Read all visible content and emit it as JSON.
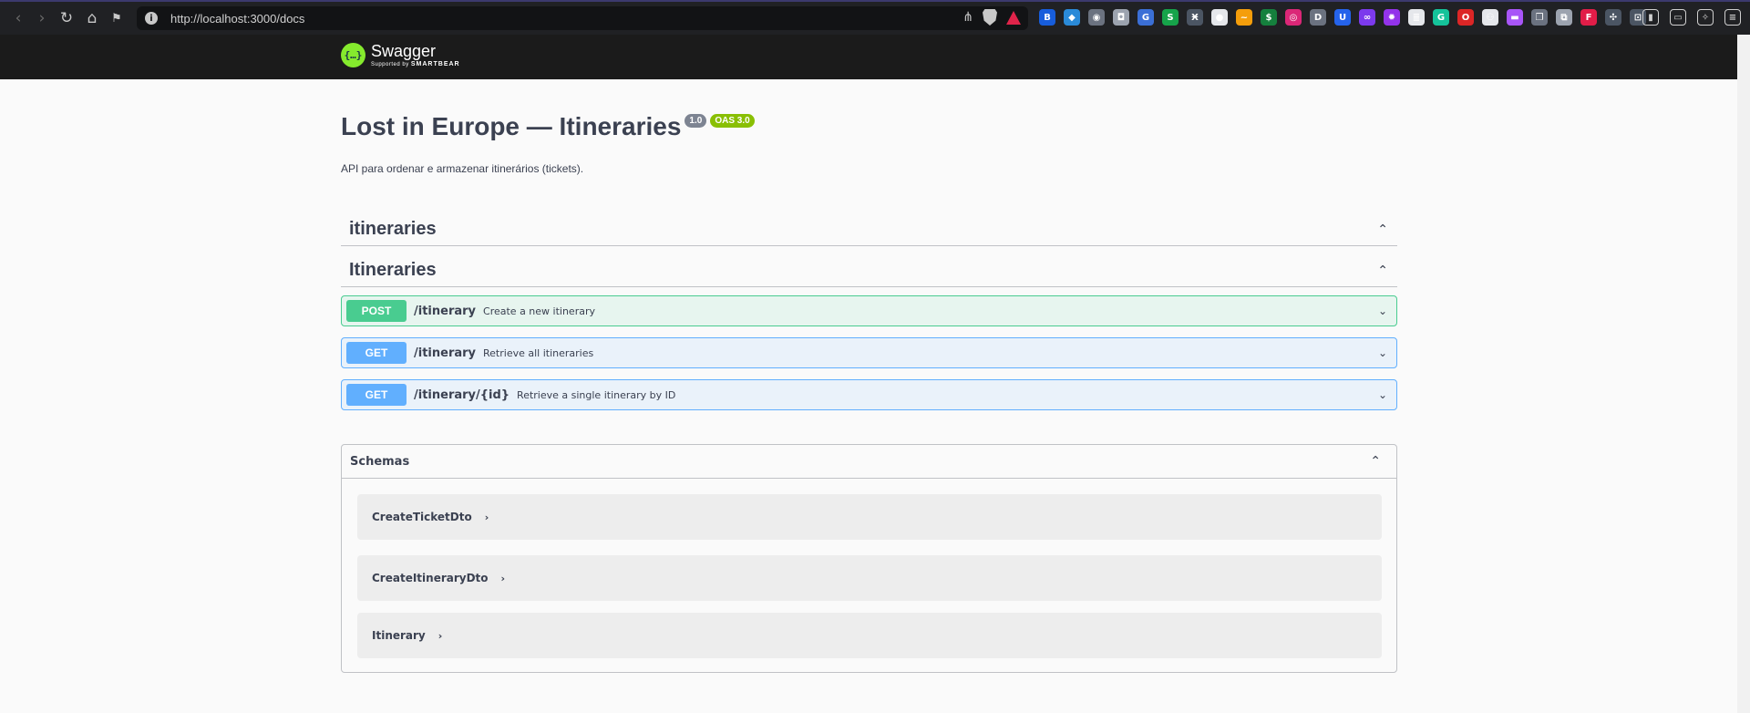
{
  "browser": {
    "url": "http://localhost:3000/docs",
    "back_icon": "‹",
    "forward_icon": "›",
    "reload_icon": "↻",
    "home_icon": "⌂",
    "bookmark_icon": "🔖",
    "info_icon": "i",
    "share_icon": "⋖",
    "extensions": [
      {
        "name": "extension-bitwarden-icon",
        "glyph": "B",
        "color": "#175ddc"
      },
      {
        "name": "extension-diamond-icon",
        "glyph": "◆",
        "color": "#2a8ad8"
      },
      {
        "name": "extension-shield-icon",
        "glyph": "◉",
        "color": "#6b7280"
      },
      {
        "name": "extension-camera-icon",
        "glyph": "◘",
        "color": "#9ca3af"
      },
      {
        "name": "extension-translate-icon",
        "glyph": "G",
        "color": "#3b6fd6"
      },
      {
        "name": "extension-s-icon",
        "glyph": "S",
        "color": "#16a34a"
      },
      {
        "name": "extension-xe-icon",
        "glyph": "Ӿ",
        "color": "#4b5563"
      },
      {
        "name": "extension-circle-icon",
        "glyph": "●",
        "color": "#e5e7eb"
      },
      {
        "name": "extension-fox-icon",
        "glyph": "~",
        "color": "#f59e0b"
      },
      {
        "name": "extension-dollar-icon",
        "glyph": "$",
        "color": "#15803d"
      },
      {
        "name": "extension-colorwheel-icon",
        "glyph": "◎",
        "color": "#db2777"
      },
      {
        "name": "extension-d-icon",
        "glyph": "D",
        "color": "#6b7280"
      },
      {
        "name": "extension-u-icon",
        "glyph": "U",
        "color": "#2563eb"
      },
      {
        "name": "extension-infinity-icon",
        "glyph": "∞",
        "color": "#7c3aed"
      },
      {
        "name": "extension-gear-icon",
        "glyph": "✹",
        "color": "#9333ea"
      },
      {
        "name": "extension-list-icon",
        "glyph": "≣",
        "color": "#e5e7eb"
      },
      {
        "name": "extension-grammarly-icon",
        "glyph": "G",
        "color": "#15c39a"
      },
      {
        "name": "extension-o-icon",
        "glyph": "O",
        "color": "#dc2626"
      },
      {
        "name": "extension-glasses-icon",
        "glyph": "⚇",
        "color": "#e5e7eb"
      },
      {
        "name": "extension-chat-icon",
        "glyph": "▬",
        "color": "#a855f7"
      },
      {
        "name": "extension-copy-icon",
        "glyph": "❐",
        "color": "#6b7280"
      },
      {
        "name": "extension-pages-icon",
        "glyph": "⧉",
        "color": "#9ca3af"
      },
      {
        "name": "extension-figma-icon",
        "glyph": "F",
        "color": "#e11d48"
      },
      {
        "name": "extension-puzzle-icon",
        "glyph": "✣",
        "color": "#4b5563"
      },
      {
        "name": "extension-screenshot-icon",
        "glyph": "⊡",
        "color": "#4b5563"
      }
    ],
    "right_icons": [
      {
        "name": "sidebar-toggle-icon",
        "glyph": "▮"
      },
      {
        "name": "wallet-icon",
        "glyph": "▭"
      },
      {
        "name": "leo-ai-icon",
        "glyph": "✧"
      },
      {
        "name": "menu-icon",
        "glyph": "≡"
      }
    ]
  },
  "topbar": {
    "logo_mark": "{…}",
    "logo_name": "Swagger",
    "logo_supported": "Supported by",
    "logo_smartbear": "SMARTBEAR"
  },
  "info": {
    "title": "Lost in Europe — Itineraries",
    "version": "1.0",
    "oas": "OAS 3.0",
    "description": "API para ordenar e armazenar itinerários (tickets)."
  },
  "tags": [
    {
      "name": "itineraries",
      "chevron": "⌃"
    },
    {
      "name": "Itineraries",
      "chevron": "⌃"
    }
  ],
  "operations": [
    {
      "method": "POST",
      "path": "/itinerary",
      "summary": "Create a new itinerary",
      "chevron": "⌄",
      "color": "#49cc90"
    },
    {
      "method": "GET",
      "path": "/itinerary",
      "summary": "Retrieve all itineraries",
      "chevron": "⌄",
      "color": "#61affe"
    },
    {
      "method": "GET",
      "path": "/itinerary/{id}",
      "summary": "Retrieve a single itinerary by ID",
      "chevron": "⌄",
      "color": "#61affe"
    }
  ],
  "schemas": {
    "title": "Schemas",
    "chevron": "⌃",
    "models": [
      {
        "name": "CreateTicketDto",
        "arrow": "›"
      },
      {
        "name": "CreateItineraryDto",
        "arrow": "›"
      },
      {
        "name": "Itinerary",
        "arrow": "›"
      }
    ]
  }
}
